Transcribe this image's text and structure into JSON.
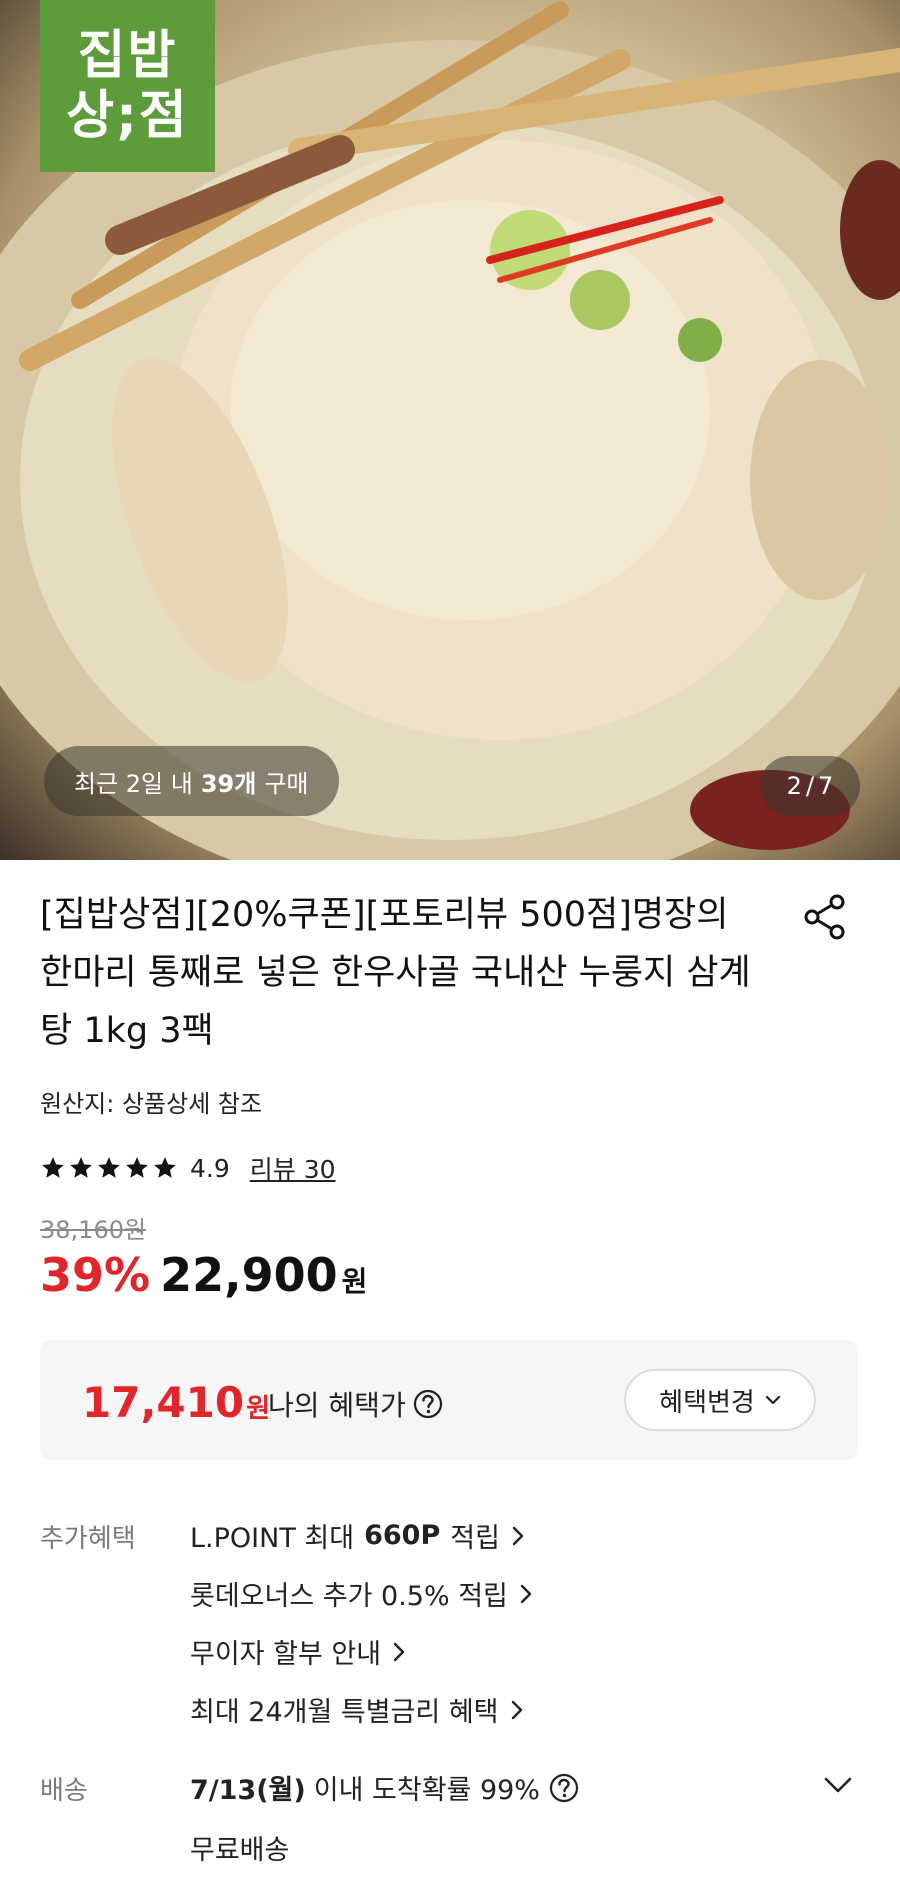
{
  "hero": {
    "logo_line1": "집밥",
    "logo_line2": "상;점",
    "recent_prefix": "최근 2일 내",
    "recent_count": "39개",
    "recent_suffix": "구매",
    "page_current": "2",
    "page_sep": "/",
    "page_total": "7"
  },
  "product": {
    "title": "[집밥상점][20%쿠폰][포토리뷰 500점]명장의 한마리 통째로 넣은 한우사골 국내산 누룽지 삼계탕 1kg 3팩",
    "origin": "원산지: 상품상세 참조",
    "rating": "4.9",
    "rating_stars": 5,
    "review_label": "리뷰 30",
    "original_price": "38,160원",
    "discount_rate": "39%",
    "sale_price": "22,900",
    "price_unit": "원"
  },
  "benefit": {
    "price": "17,410",
    "unit": "원",
    "label": "나의 혜택가",
    "change_button": "혜택변경"
  },
  "extra": {
    "label": "추가혜택",
    "lpoint_prefix": "L.POINT 최대",
    "lpoint_amount": "660P",
    "lpoint_suffix": "적립",
    "items": [
      "롯데오너스 추가 0.5% 적립",
      "무이자 할부 안내",
      "최대 24개월 특별금리 혜택"
    ]
  },
  "shipping": {
    "label": "배송",
    "date": "7/13(월)",
    "text": "이내 도착확률 99%",
    "free": "무료배송"
  },
  "colors": {
    "accent_red": "#e0262b",
    "brand_green": "#5e9b3a"
  },
  "icons": [
    "share-icon",
    "star-icon",
    "question-icon",
    "chevron-down-icon",
    "chevron-right-icon"
  ]
}
